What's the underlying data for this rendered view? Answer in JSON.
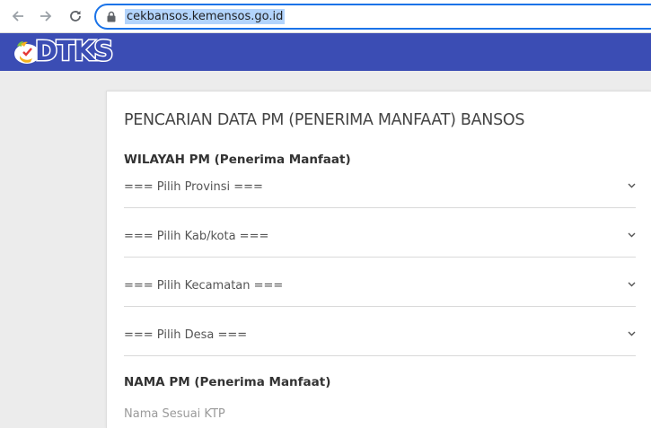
{
  "browser": {
    "url": "cekbansos.kemensos.go.id",
    "icons": [
      "back-arrow-icon",
      "forward-arrow-icon",
      "reload-icon",
      "lock-icon"
    ]
  },
  "header": {
    "logo_text": "DTKS",
    "brand_color": "#3b4db4"
  },
  "form": {
    "title": "PENCARIAN DATA PM (PENERIMA MANFAAT) BANSOS",
    "wilayah_label": "WILAYAH PM (Penerima Manfaat)",
    "provinsi": "=== Pilih Provinsi ===",
    "kabkota": "=== Pilih Kab/kota ===",
    "kecamatan": "=== Pilih Kecamatan ===",
    "desa": "=== Pilih Desa ===",
    "nama_label": "NAMA PM (Penerima Manfaat)",
    "nama_placeholder": "Nama Sesuai KTP",
    "nama_value": ""
  }
}
